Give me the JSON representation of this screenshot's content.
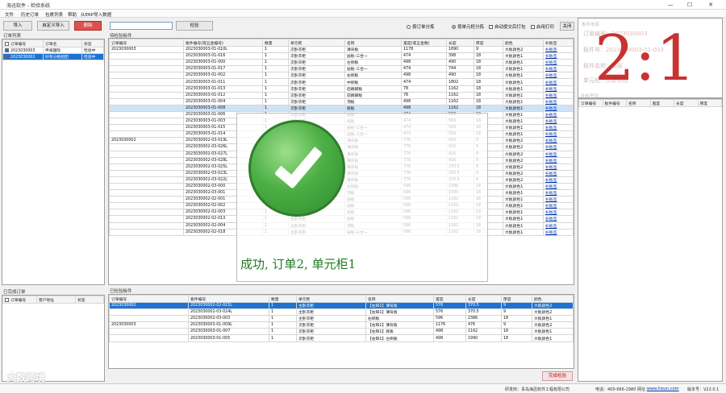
{
  "window": {
    "title": "海迅软件 - 检验系统",
    "minimize": "—",
    "maximize": "☐",
    "close": "✕"
  },
  "menu": [
    "文件",
    "历史订单",
    "包裹列表",
    "帮助",
    "从ERP导入数据"
  ],
  "left": {
    "order_list_label": "订单列表",
    "btn_import": "导入",
    "btn_custom_import": "自定义导入",
    "btn_delete": "删除",
    "columns": [
      "订单编号",
      "订单名",
      "状态"
    ],
    "rows": [
      {
        "id": "2023030003",
        "name": "申海国际",
        "status": "检验中",
        "checked": true,
        "selected": false
      },
      {
        "id": "2023030002",
        "name": "好有分格组团",
        "status": "检验中",
        "checked": true,
        "selected": true
      }
    ],
    "done_label": "已完成订单",
    "done_columns": [
      "订单编号",
      "客户地址",
      "状态"
    ]
  },
  "search": {
    "placeholder": "",
    "btn_check": "检验"
  },
  "options": {
    "by_order": "按订单分拣",
    "by_cabinet": "按单元柜分拣",
    "auto_print": "自动提交后打包",
    "enable_print": "启用打印",
    "close": "关闭"
  },
  "pending": {
    "label": "待检验板件",
    "columns": [
      "订单编号",
      "板件编号(或五金编号)",
      "数量",
      "单元柜",
      "名称",
      "宽度(或五金数)",
      "长度",
      "厚度",
      "颜色",
      "补板签"
    ],
    "rows": [
      {
        "order": "2023030003",
        "code": "2023030003-01-010L",
        "qty": "1",
        "cab": "次卧衣柜",
        "name": "薄背板",
        "w": "1178",
        "l": "1890",
        "t": "9",
        "color": "大板颜色2",
        "tag": "补板签",
        "cls": ""
      },
      {
        "order": "",
        "code": "2023030003-01-016",
        "qty": "1",
        "cab": "次卧衣柜",
        "name": "层板-三合一",
        "w": "474",
        "l": "398",
        "t": "18",
        "color": "大板颜色1",
        "tag": "补板签",
        "cls": ""
      },
      {
        "order": "",
        "code": "2023030003-01-000",
        "qty": "1",
        "cab": "次卧衣柜",
        "name": "左侧板",
        "w": "498",
        "l": "490",
        "t": "18",
        "color": "大板颜色1",
        "tag": "补板签",
        "cls": ""
      },
      {
        "order": "",
        "code": "2023030003-01-017",
        "qty": "1",
        "cab": "次卧衣柜",
        "name": "层板-三合一",
        "w": "474",
        "l": "744",
        "t": "18",
        "color": "大板颜色1",
        "tag": "补板签",
        "cls": ""
      },
      {
        "order": "",
        "code": "2023030003-01-002",
        "qty": "1",
        "cab": "次卧衣柜",
        "name": "右侧板",
        "w": "498",
        "l": "490",
        "t": "18",
        "color": "大板颜色1",
        "tag": "补板签",
        "cls": ""
      },
      {
        "order": "",
        "code": "2023030003-01-011",
        "qty": "1",
        "cab": "次卧衣柜",
        "name": "中侧板",
        "w": "474",
        "l": "1802",
        "t": "18",
        "color": "大板颜色1",
        "tag": "补板签",
        "cls": ""
      },
      {
        "order": "",
        "code": "2023030003-01-013",
        "qty": "1",
        "cab": "次卧衣柜",
        "name": "后踢脚板",
        "w": "78",
        "l": "1162",
        "t": "18",
        "color": "大板颜色1",
        "tag": "补板签",
        "cls": ""
      },
      {
        "order": "",
        "code": "2023030003-01-012",
        "qty": "1",
        "cab": "次卧衣柜",
        "name": "前踢脚板",
        "w": "78",
        "l": "1162",
        "t": "18",
        "color": "大板颜色1",
        "tag": "补板签",
        "cls": ""
      },
      {
        "order": "",
        "code": "2023030003-01-004",
        "qty": "1",
        "cab": "次卧衣柜",
        "name": "顶板",
        "w": "498",
        "l": "1162",
        "t": "18",
        "color": "大板颜色1",
        "tag": "补板签",
        "cls": ""
      },
      {
        "order": "",
        "code": "2023030003-01-008",
        "qty": "1",
        "cab": "次卧衣柜",
        "name": "底板",
        "w": "498",
        "l": "1162",
        "t": "18",
        "color": "大板颜色1",
        "tag": "补板签",
        "cls": "lightsel"
      },
      {
        "order": "",
        "code": "2023030003-01-006",
        "qty": "1",
        "cab": "次卧衣柜",
        "name": "层板",
        "w": "474",
        "l": "569",
        "t": "18",
        "color": "大板颜色1",
        "tag": "补板签",
        "cls": ""
      },
      {
        "order": "",
        "code": "2023030003-01-003",
        "qty": "1",
        "cab": "次卧衣柜",
        "name": "层板",
        "w": "474",
        "l": "569",
        "t": "18",
        "color": "大板颜色1",
        "tag": "补板签",
        "cls": ""
      },
      {
        "order": "",
        "code": "2023030003-01-015",
        "qty": "1",
        "cab": "次卧衣柜",
        "name": "层板-三合一",
        "w": "474",
        "l": "569",
        "t": "18",
        "color": "大板颜色1",
        "tag": "补板签",
        "cls": ""
      },
      {
        "order": "",
        "code": "2023030003-01-014",
        "qty": "1",
        "cab": "次卧衣柜",
        "name": "层板-三合一",
        "w": "474",
        "l": "569",
        "t": "18",
        "color": "大板颜色1",
        "tag": "补板签",
        "cls": ""
      },
      {
        "order": "2023030002",
        "code": "2023030002-03-019L",
        "qty": "1",
        "cab": "主卧衣柜",
        "name": "薄背板",
        "w": "776",
        "l": "416",
        "t": "9",
        "color": "大板颜色2",
        "tag": "补板签",
        "cls": ""
      },
      {
        "order": "",
        "code": "2023030002-03-026L",
        "qty": "1",
        "cab": "主卧衣柜",
        "name": "薄背板",
        "w": "776",
        "l": "416",
        "t": "9",
        "color": "大板颜色2",
        "tag": "补板签",
        "cls": ""
      },
      {
        "order": "",
        "code": "2023030002-03-027L",
        "qty": "1",
        "cab": "主卧衣柜",
        "name": "薄背板",
        "w": "776",
        "l": "416",
        "t": "9",
        "color": "大板颜色2",
        "tag": "补板签",
        "cls": ""
      },
      {
        "order": "",
        "code": "2023030002-03-028L",
        "qty": "1",
        "cab": "主卧衣柜",
        "name": "薄背板",
        "w": "776",
        "l": "416",
        "t": "9",
        "color": "大板颜色2",
        "tag": "补板签",
        "cls": ""
      },
      {
        "order": "",
        "code": "2023030002-03-025L",
        "qty": "1",
        "cab": "主卧衣柜",
        "name": "薄背板",
        "w": "776",
        "l": "370.5",
        "t": "9",
        "color": "大板颜色2",
        "tag": "补板签",
        "cls": ""
      },
      {
        "order": "",
        "code": "2023030002-03-023L",
        "qty": "1",
        "cab": "主卧衣柜",
        "name": "薄背板",
        "w": "776",
        "l": "370.5",
        "t": "9",
        "color": "大板颜色2",
        "tag": "补板签",
        "cls": ""
      },
      {
        "order": "",
        "code": "2023030002-03-022L",
        "qty": "1",
        "cab": "主卧衣柜",
        "name": "薄背板",
        "w": "776",
        "l": "370.5",
        "t": "9",
        "color": "大板颜色2",
        "tag": "补板签",
        "cls": ""
      },
      {
        "order": "",
        "code": "2023030002-03-000",
        "qty": "1",
        "cab": "主卧衣柜",
        "name": "左侧板",
        "w": "596",
        "l": "2386",
        "t": "18",
        "color": "大板颜色1",
        "tag": "补板签",
        "cls": ""
      },
      {
        "order": "",
        "code": "2023030002-03-001",
        "qty": "1",
        "cab": "主卧衣柜",
        "name": "顶板",
        "w": "596",
        "l": "1500",
        "t": "18",
        "color": "大板颜色1",
        "tag": "补板签",
        "cls": ""
      },
      {
        "order": "",
        "code": "2023030002-02-001",
        "qty": "1",
        "cab": "主卧衣柜",
        "name": "层板",
        "w": "596",
        "l": "1162",
        "t": "18",
        "color": "大板颜色1",
        "tag": "补板签",
        "cls": ""
      },
      {
        "order": "",
        "code": "2023030002-02-002",
        "qty": "1",
        "cab": "主卧衣柜",
        "name": "层板",
        "w": "596",
        "l": "1162",
        "t": "18",
        "color": "大板颜色1",
        "tag": "补板签",
        "cls": ""
      },
      {
        "order": "",
        "code": "2023030002-02-003",
        "qty": "1",
        "cab": "主卧衣柜",
        "name": "层板",
        "w": "596",
        "l": "1162",
        "t": "18",
        "color": "大板颜色1",
        "tag": "补板签",
        "cls": ""
      },
      {
        "order": "",
        "code": "2023030002-02-013",
        "qty": "1",
        "cab": "主卧衣柜",
        "name": "层板",
        "w": "596",
        "l": "1162",
        "t": "18",
        "color": "大板颜色1",
        "tag": "补板签",
        "cls": ""
      },
      {
        "order": "",
        "code": "2023030002-02-004",
        "qty": "1",
        "cab": "主卧衣柜",
        "name": "顶板",
        "w": "596",
        "l": "1162",
        "t": "18",
        "color": "大板颜色1",
        "tag": "补板签",
        "cls": ""
      },
      {
        "order": "",
        "code": "2023030002-02-018",
        "qty": "1",
        "cab": "主卧衣柜",
        "name": "层板-三合一",
        "w": "596",
        "l": "1162",
        "t": "18",
        "color": "大板颜色1",
        "tag": "补板签",
        "cls": ""
      }
    ]
  },
  "checked": {
    "label": "已检验板件",
    "columns": [
      "订单编号",
      "板件编号",
      "数量",
      "单元柜",
      "名称",
      "宽度",
      "长度",
      "厚度",
      "颜色"
    ],
    "rows": [
      {
        "order": "2023030002",
        "code": "2023030002-02-021L",
        "qty": "1",
        "cab": "主卧衣柜",
        "name": "【右缺1】薄背板",
        "w": "576",
        "l": "370.5",
        "t": "9",
        "color": "大板颜色2",
        "cls": "sel"
      },
      {
        "order": "",
        "code": "2023030002-03-024L",
        "qty": "1",
        "cab": "主卧衣柜",
        "name": "【右缺1】薄背板",
        "w": "576",
        "l": "370.5",
        "t": "9",
        "color": "大板颜色2",
        "cls": ""
      },
      {
        "order": "",
        "code": "2023030002-03-003",
        "qty": "1",
        "cab": "主卧衣柜",
        "name": "右侧板",
        "w": "596",
        "l": "2386",
        "t": "18",
        "color": "大板颜色1",
        "cls": ""
      },
      {
        "order": "2023030003",
        "code": "2023030003-01-009L",
        "qty": "1",
        "cab": "次卧衣柜",
        "name": "【右缺1】薄背板",
        "w": "1176",
        "l": "476",
        "t": "9",
        "color": "大板颜色2",
        "cls": ""
      },
      {
        "order": "",
        "code": "2023030003-01-007",
        "qty": "1",
        "cab": "次卧衣柜",
        "name": "【右缺1】底板",
        "w": "498",
        "l": "1162",
        "t": "18",
        "color": "大板颜色1",
        "cls": ""
      },
      {
        "order": "",
        "code": "2023030003-01-005",
        "qty": "1",
        "cab": "次卧衣柜",
        "name": "【右缺1】左侧板",
        "w": "498",
        "l": "1990",
        "t": "18",
        "color": "大板颜色1",
        "cls": ""
      }
    ],
    "btn_finish": "完成检验"
  },
  "right": {
    "info_label": "板件信息",
    "order_no_label": "订单编号：",
    "order_no": "2023030003",
    "board_label": "板件号：",
    "board": "2023030003-01-003",
    "name_label": "板件名称：",
    "name": "层板",
    "cab_label": "单元柜：",
    "cab": "次卧衣柜",
    "big_count": "2:1",
    "sub_label": "补板签列",
    "sub_columns": [
      "订单编号",
      "板件编号",
      "名称",
      "宽度",
      "长度",
      "厚度"
    ]
  },
  "overlay": {
    "message": "成功, 订单2, 单元柜1"
  },
  "status": {
    "dev": "研发商：青岛海迅软件工程有限公司",
    "phone": "电话：400-666-2980",
    "site_label": "网址：",
    "site": "www.hixun.com",
    "version": "版本号：V22.0.1"
  },
  "watermark": "大数跨境"
}
